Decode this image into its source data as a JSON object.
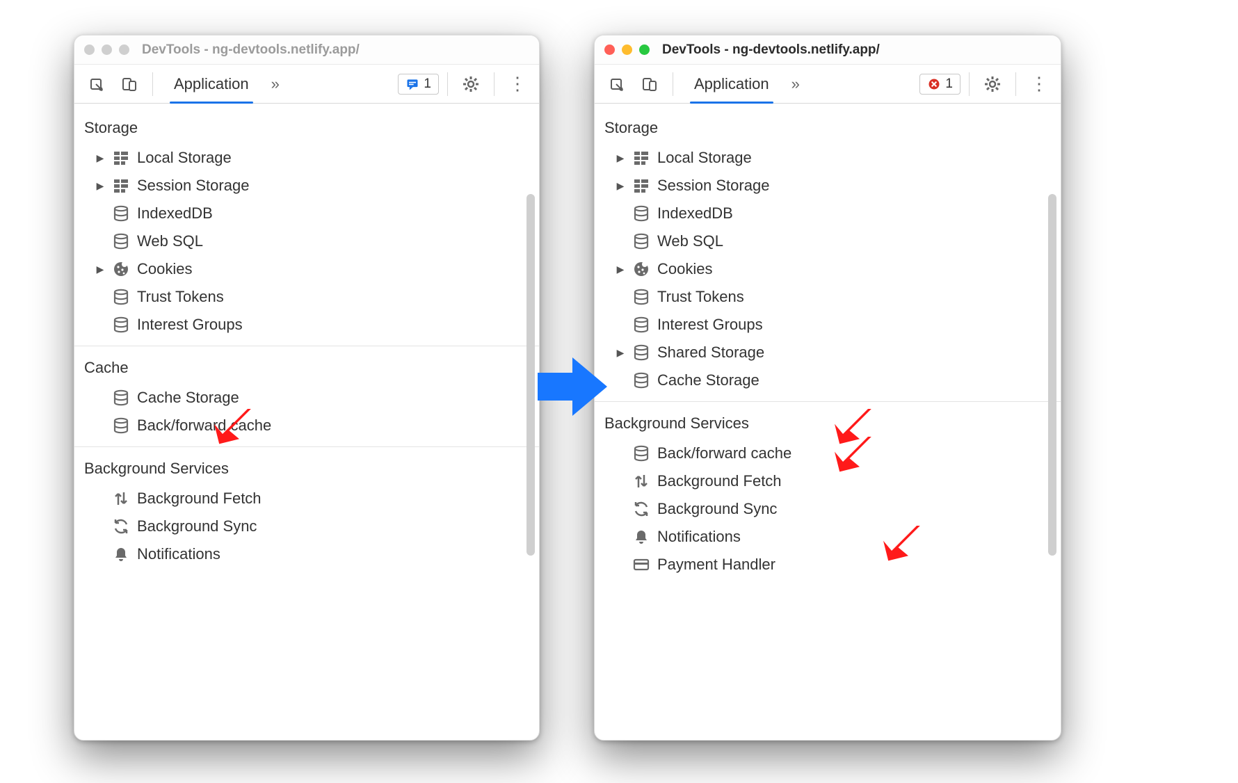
{
  "window_title": "DevTools - ng-devtools.netlify.app/",
  "tab_label": "Application",
  "overflow_glyph": "»",
  "badge_count": "1",
  "left": {
    "sections": [
      {
        "header": "Storage",
        "items": [
          {
            "label": "Local Storage",
            "icon": "grid",
            "caret": true
          },
          {
            "label": "Session Storage",
            "icon": "grid",
            "caret": true
          },
          {
            "label": "IndexedDB",
            "icon": "db",
            "caret": false
          },
          {
            "label": "Web SQL",
            "icon": "db",
            "caret": false
          },
          {
            "label": "Cookies",
            "icon": "cookie",
            "caret": true
          },
          {
            "label": "Trust Tokens",
            "icon": "db",
            "caret": false
          },
          {
            "label": "Interest Groups",
            "icon": "db",
            "caret": false
          }
        ]
      },
      {
        "header": "Cache",
        "items": [
          {
            "label": "Cache Storage",
            "icon": "db",
            "caret": false
          },
          {
            "label": "Back/forward cache",
            "icon": "db",
            "caret": false
          }
        ]
      },
      {
        "header": "Background Services",
        "items": [
          {
            "label": "Background Fetch",
            "icon": "updown",
            "caret": false
          },
          {
            "label": "Background Sync",
            "icon": "sync",
            "caret": false
          },
          {
            "label": "Notifications",
            "icon": "bell",
            "caret": false
          }
        ]
      }
    ]
  },
  "right": {
    "sections": [
      {
        "header": "Storage",
        "items": [
          {
            "label": "Local Storage",
            "icon": "grid",
            "caret": true
          },
          {
            "label": "Session Storage",
            "icon": "grid",
            "caret": true
          },
          {
            "label": "IndexedDB",
            "icon": "db",
            "caret": false
          },
          {
            "label": "Web SQL",
            "icon": "db",
            "caret": false
          },
          {
            "label": "Cookies",
            "icon": "cookie",
            "caret": true
          },
          {
            "label": "Trust Tokens",
            "icon": "db",
            "caret": false
          },
          {
            "label": "Interest Groups",
            "icon": "db",
            "caret": false
          },
          {
            "label": "Shared Storage",
            "icon": "db",
            "caret": true
          },
          {
            "label": "Cache Storage",
            "icon": "db",
            "caret": false
          }
        ]
      },
      {
        "header": "Background Services",
        "items": [
          {
            "label": "Back/forward cache",
            "icon": "db",
            "caret": false
          },
          {
            "label": "Background Fetch",
            "icon": "updown",
            "caret": false
          },
          {
            "label": "Background Sync",
            "icon": "sync",
            "caret": false
          },
          {
            "label": "Notifications",
            "icon": "bell",
            "caret": false
          },
          {
            "label": "Payment Handler",
            "icon": "card",
            "caret": false
          }
        ]
      }
    ]
  }
}
